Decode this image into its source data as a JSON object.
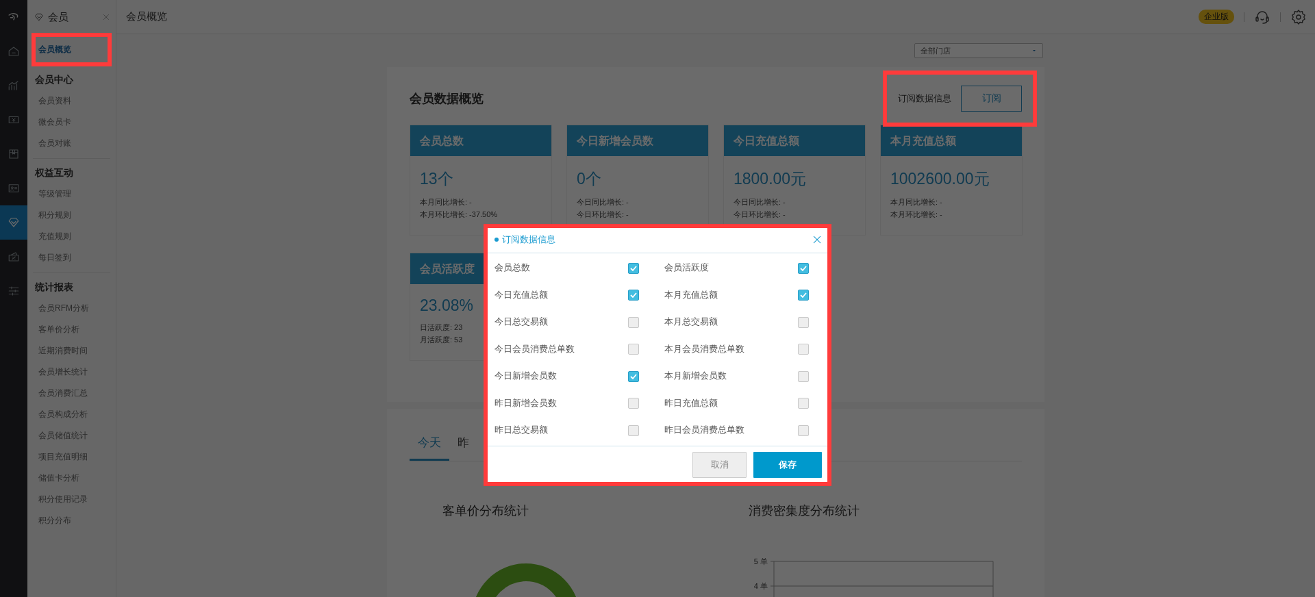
{
  "rail": [
    {
      "selected": false
    },
    {
      "selected": false
    },
    {
      "selected": false
    },
    {
      "selected": false
    },
    {
      "selected": false
    },
    {
      "selected": false
    },
    {
      "selected": true
    },
    {
      "selected": false
    },
    {
      "selected": false
    }
  ],
  "submenu": {
    "title": "会员",
    "home": {
      "label": "会员概览",
      "selected": true,
      "highlighted": true
    },
    "groups": [
      {
        "title": "会员中心",
        "items": [
          {
            "label": "会员资料",
            "selected": false
          },
          {
            "label": "微会员卡",
            "selected": false
          },
          {
            "label": "会员对账",
            "selected": false
          }
        ]
      },
      {
        "title": "权益互动",
        "items": [
          {
            "label": "等级管理",
            "selected": false
          },
          {
            "label": "积分规则",
            "selected": false
          },
          {
            "label": "充值规则",
            "selected": false
          },
          {
            "label": "每日签到",
            "selected": false
          }
        ]
      },
      {
        "title": "统计报表",
        "items": [
          {
            "label": "会员RFM分析",
            "selected": false
          },
          {
            "label": "客单价分析",
            "selected": false
          },
          {
            "label": "近期消费时间",
            "selected": false
          },
          {
            "label": "会员增长统计",
            "selected": false
          },
          {
            "label": "会员消费汇总",
            "selected": false
          },
          {
            "label": "会员构成分析",
            "selected": false
          },
          {
            "label": "会员储值统计",
            "selected": false
          },
          {
            "label": "项目充值明细",
            "selected": false
          },
          {
            "label": "储值卡分析",
            "selected": false
          },
          {
            "label": "积分使用记录",
            "selected": false
          },
          {
            "label": "积分分布",
            "selected": false
          }
        ]
      }
    ]
  },
  "topbar": {
    "title": "会员概览",
    "badge": "企业版"
  },
  "filter": {
    "store_select": "全部门店"
  },
  "overview": {
    "title": "会员数据概览",
    "subscribe_label": "订阅数据信息",
    "subscribe_button": "订阅",
    "highlighted": true,
    "stats": [
      {
        "title": "会员总数",
        "value": "13个",
        "lines": [
          "本月同比增长: -",
          "本月环比增长: -37.50%"
        ]
      },
      {
        "title": "今日新增会员数",
        "value": "0个",
        "lines": [
          "今日同比增长: -",
          "今日环比增长: -"
        ]
      },
      {
        "title": "今日充值总额",
        "value": "1800.00元",
        "lines": [
          "今日同比增长: -",
          "今日环比增长: -"
        ]
      },
      {
        "title": "本月充值总额",
        "value": "1002600.00元",
        "lines": [
          "本月同比增长: -",
          "本月环比增长: -"
        ]
      },
      {
        "title": "会员活跃度",
        "value": "23.08%",
        "lines": [
          "日活跃度: 23",
          "月活跃度: 53"
        ]
      }
    ]
  },
  "report": {
    "tabs": [
      {
        "label": "今天",
        "selected": true
      },
      {
        "label": "昨",
        "selected": false
      }
    ],
    "charts": [
      {
        "kind": "donut",
        "title": "客单价分布统计"
      },
      {
        "kind": "axes",
        "title": "消费密集度分布统计",
        "y_tick_labels": [
          "5 单",
          "4 单"
        ]
      }
    ]
  },
  "dialog": {
    "title": "订阅数据信息",
    "highlighted": true,
    "options": [
      {
        "label": "会员总数",
        "checked": true
      },
      {
        "label": "会员活跃度",
        "checked": true
      },
      {
        "label": "今日充值总额",
        "checked": true
      },
      {
        "label": "本月充值总额",
        "checked": true
      },
      {
        "label": "今日总交易额",
        "checked": false
      },
      {
        "label": "本月总交易额",
        "checked": false
      },
      {
        "label": "今日会员消费总单数",
        "checked": false
      },
      {
        "label": "本月会员消费总单数",
        "checked": false
      },
      {
        "label": "今日新增会员数",
        "checked": true
      },
      {
        "label": "本月新增会员数",
        "checked": false
      },
      {
        "label": "昨日新增会员数",
        "checked": false
      },
      {
        "label": "昨日充值总额",
        "checked": false
      },
      {
        "label": "昨日总交易额",
        "checked": false
      },
      {
        "label": "昨日会员消费总单数",
        "checked": false
      }
    ],
    "buttons": [
      {
        "label": "取消",
        "kind": "cancel",
        "disabled": true
      },
      {
        "label": "保存",
        "kind": "save",
        "disabled": false
      }
    ]
  }
}
